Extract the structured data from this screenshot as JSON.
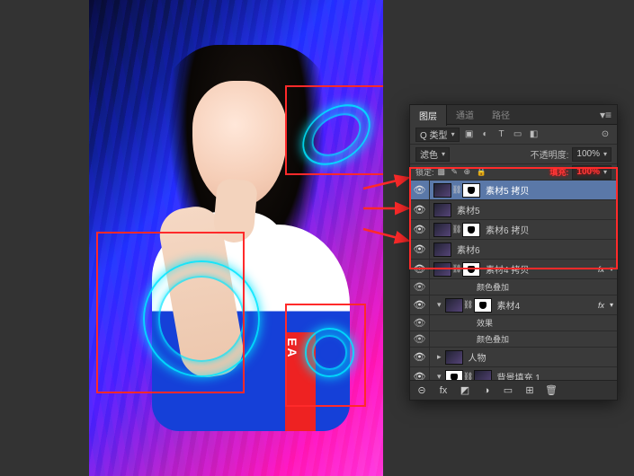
{
  "canvas": {
    "shirt_text": "EA"
  },
  "panel": {
    "tabs": [
      "图层",
      "通道",
      "路径"
    ],
    "active_tab": 0,
    "row1": {
      "kind_label": "Q 类型",
      "opacity_label": "不透明度:",
      "opacity_value": "100%"
    },
    "row2": {
      "blend_mode": "滤色",
      "fill_label": "填充:",
      "fill_value": "100%"
    },
    "row3": {
      "lock_label": "锁定:",
      "fill_label_red": "填充:",
      "fill_value_red": "100%"
    },
    "layers": [
      {
        "indent": 0,
        "name": "素材5 拷贝",
        "selected": true,
        "thumbs": [
          "dark",
          "mask"
        ],
        "fx": false
      },
      {
        "indent": 0,
        "name": "素材5",
        "selected": false,
        "thumbs": [
          "dark"
        ],
        "fx": false
      },
      {
        "indent": 0,
        "name": "素材6 拷贝",
        "selected": false,
        "thumbs": [
          "dark",
          "mask"
        ],
        "fx": false
      },
      {
        "indent": 0,
        "name": "素材6",
        "selected": false,
        "thumbs": [
          "dark"
        ],
        "fx": false
      },
      {
        "indent": 0,
        "name": "素材4 拷贝",
        "selected": false,
        "thumbs": [
          "dark",
          "mask"
        ],
        "fx": true
      },
      {
        "indent": 2,
        "name": "颜色叠加",
        "selected": false,
        "sub": true
      },
      {
        "indent": 0,
        "name": "素材4",
        "selected": false,
        "thumbs": [
          "dark",
          "mask"
        ],
        "fx": true,
        "disc": true
      },
      {
        "indent": 2,
        "name": "效果",
        "selected": false,
        "sub": true
      },
      {
        "indent": 2,
        "name": "颜色叠加",
        "selected": false,
        "sub": true
      },
      {
        "indent": 0,
        "name": "人物",
        "selected": false,
        "thumbs": [
          "dark"
        ],
        "bigdisc": true
      },
      {
        "indent": 0,
        "name": "背景填充 1",
        "selected": false,
        "thumbs": [
          "mask",
          "dark"
        ],
        "disc": true
      }
    ],
    "effects_label": "效果",
    "coloroverlay_label": "颜色叠加",
    "fx_abbr": "fx"
  },
  "footer": {
    "icons": [
      "⊝",
      "fx",
      "◩",
      "◑",
      "▭",
      "⊞",
      "🗑"
    ]
  }
}
